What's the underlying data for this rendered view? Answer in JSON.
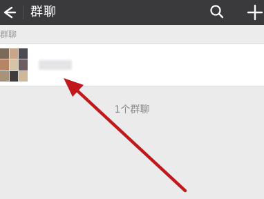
{
  "header": {
    "title": "群聊",
    "back_icon": "arrow-left-icon",
    "search_icon": "search-icon",
    "add_icon": "plus-icon"
  },
  "section": {
    "label": "群聊"
  },
  "group_list": {
    "items": [
      {
        "avatar_icon": "group-avatar-collage",
        "name_blurred": true
      }
    ]
  },
  "footer": {
    "count_text": "1个群聊"
  },
  "annotation": {
    "color": "#c0181c"
  },
  "colors": {
    "topbar": "#3a3a3c",
    "background": "#ebebeb",
    "row": "#ffffff"
  }
}
